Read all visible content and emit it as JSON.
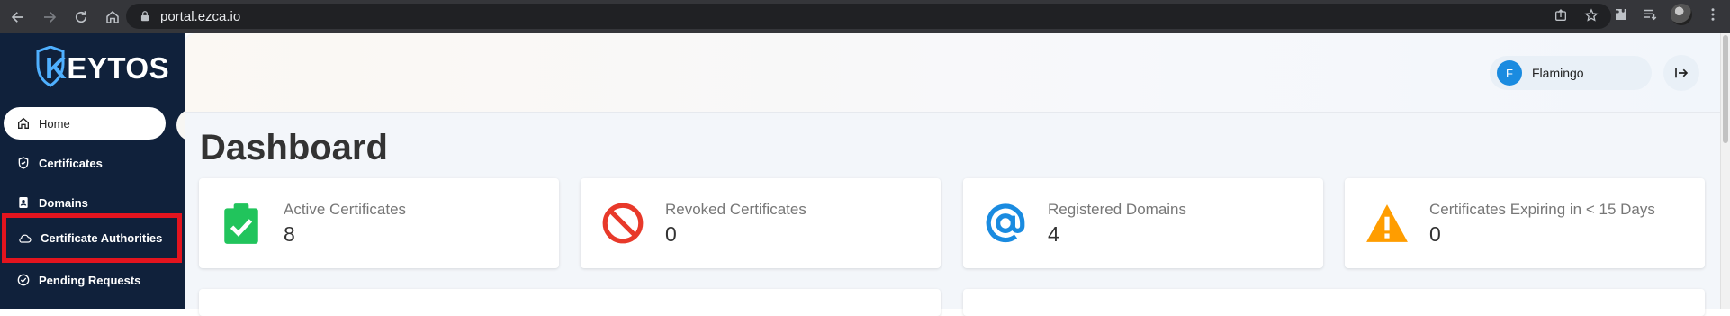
{
  "browser": {
    "url": "portal.ezca.io"
  },
  "sidebar": {
    "logo_prefix": "K",
    "logo_rest": "EYTOS",
    "items": [
      {
        "label": "Home",
        "icon": "home-icon"
      },
      {
        "label": "Certificates",
        "icon": "shield-check-icon"
      },
      {
        "label": "Domains",
        "icon": "id-card-icon"
      },
      {
        "label": "Certificate Authorities",
        "icon": "cloud-icon"
      },
      {
        "label": "Pending Requests",
        "icon": "check-circle-icon"
      }
    ]
  },
  "header": {
    "user_initial": "F",
    "user_name": "Flamingo"
  },
  "main": {
    "title": "Dashboard",
    "cards": [
      {
        "label": "Active Certificates",
        "value": "8",
        "icon": "clipboard-check-icon",
        "color": "#21c45c"
      },
      {
        "label": "Revoked Certificates",
        "value": "0",
        "icon": "prohibited-icon",
        "color": "#e8392a"
      },
      {
        "label": "Registered Domains",
        "value": "4",
        "icon": "at-sign-icon",
        "color": "#1a8be0"
      },
      {
        "label": "Certificates Expiring in < 15 Days",
        "value": "0",
        "icon": "warning-icon",
        "color": "#ff9d00"
      }
    ]
  },
  "colors": {
    "sidebar_bg": "#10213b",
    "highlight": "#e3141e",
    "accent": "#1a8be0"
  }
}
